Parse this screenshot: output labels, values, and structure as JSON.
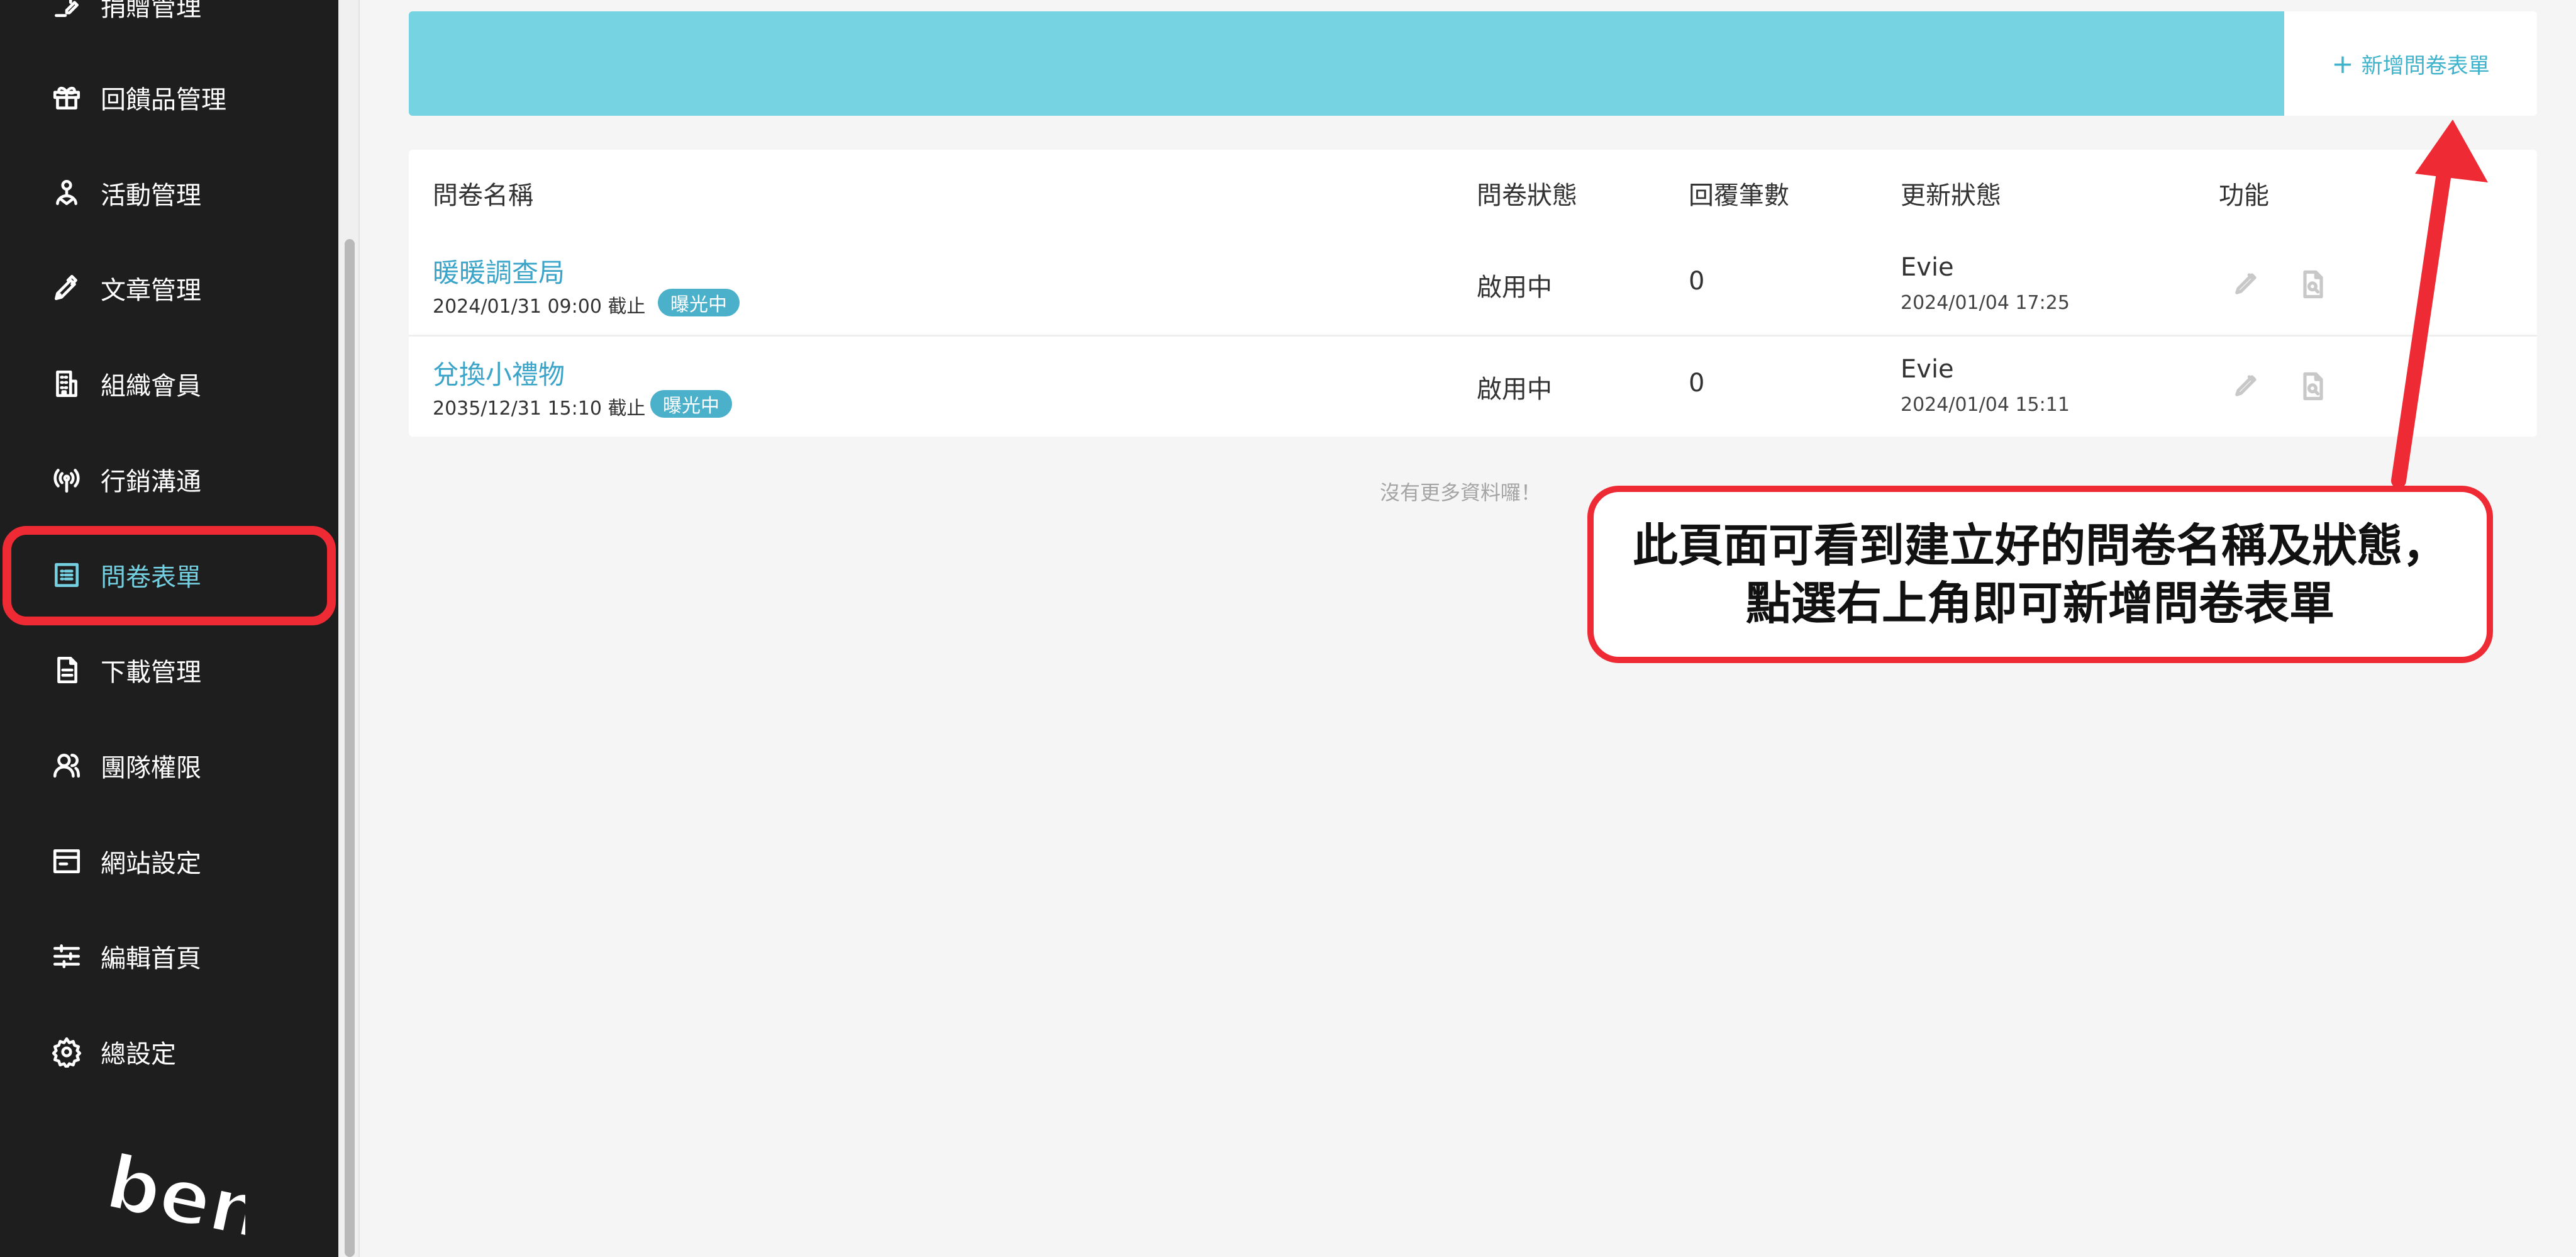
{
  "sidebar": {
    "items": [
      {
        "label": "捐贈管理",
        "icon": "edit-note-icon"
      },
      {
        "label": "回饋品管理",
        "icon": "gift-icon"
      },
      {
        "label": "活動管理",
        "icon": "activity-icon"
      },
      {
        "label": "文章管理",
        "icon": "pen-icon"
      },
      {
        "label": "組織會員",
        "icon": "building-icon"
      },
      {
        "label": "行銷溝通",
        "icon": "broadcast-icon"
      },
      {
        "label": "問卷表單",
        "icon": "list-form-icon",
        "active": true
      },
      {
        "label": "下載管理",
        "icon": "document-icon"
      },
      {
        "label": "團隊權限",
        "icon": "users-icon"
      },
      {
        "label": "網站設定",
        "icon": "browser-window-icon"
      },
      {
        "label": "編輯首頁",
        "icon": "sliders-icon"
      },
      {
        "label": "總設定",
        "icon": "gear-icon"
      }
    ],
    "logo_text": "ben"
  },
  "header": {
    "add_button": "新增問卷表單",
    "add_icon": "plus-icon"
  },
  "table": {
    "columns": [
      "問卷名稱",
      "問卷狀態",
      "回覆筆數",
      "更新狀態",
      "功能"
    ],
    "rows": [
      {
        "name": "暖暖調查局",
        "deadline": "2024/01/31 09:00 截止",
        "badge": "曝光中",
        "status": "啟用中",
        "responses": "0",
        "updated_by": "Evie",
        "updated_at": "2024/01/04 17:25"
      },
      {
        "name": "兌換小禮物",
        "deadline": "2035/12/31 15:10 截止",
        "badge": "曝光中",
        "status": "啟用中",
        "responses": "0",
        "updated_by": "Evie",
        "updated_at": "2024/01/04 15:11"
      }
    ],
    "empty_text": "沒有更多資料囉！"
  },
  "annotation": {
    "line1": "此頁面可看到建立好的問卷名稱及狀態，",
    "line2": "點選右上角即可新增問卷表單"
  },
  "colors": {
    "sidebar_bg": "#1e1e1e",
    "accent": "#76d3e1",
    "link": "#3aa4c9",
    "badge": "#4bb0ca",
    "highlight": "#ee2b34"
  }
}
